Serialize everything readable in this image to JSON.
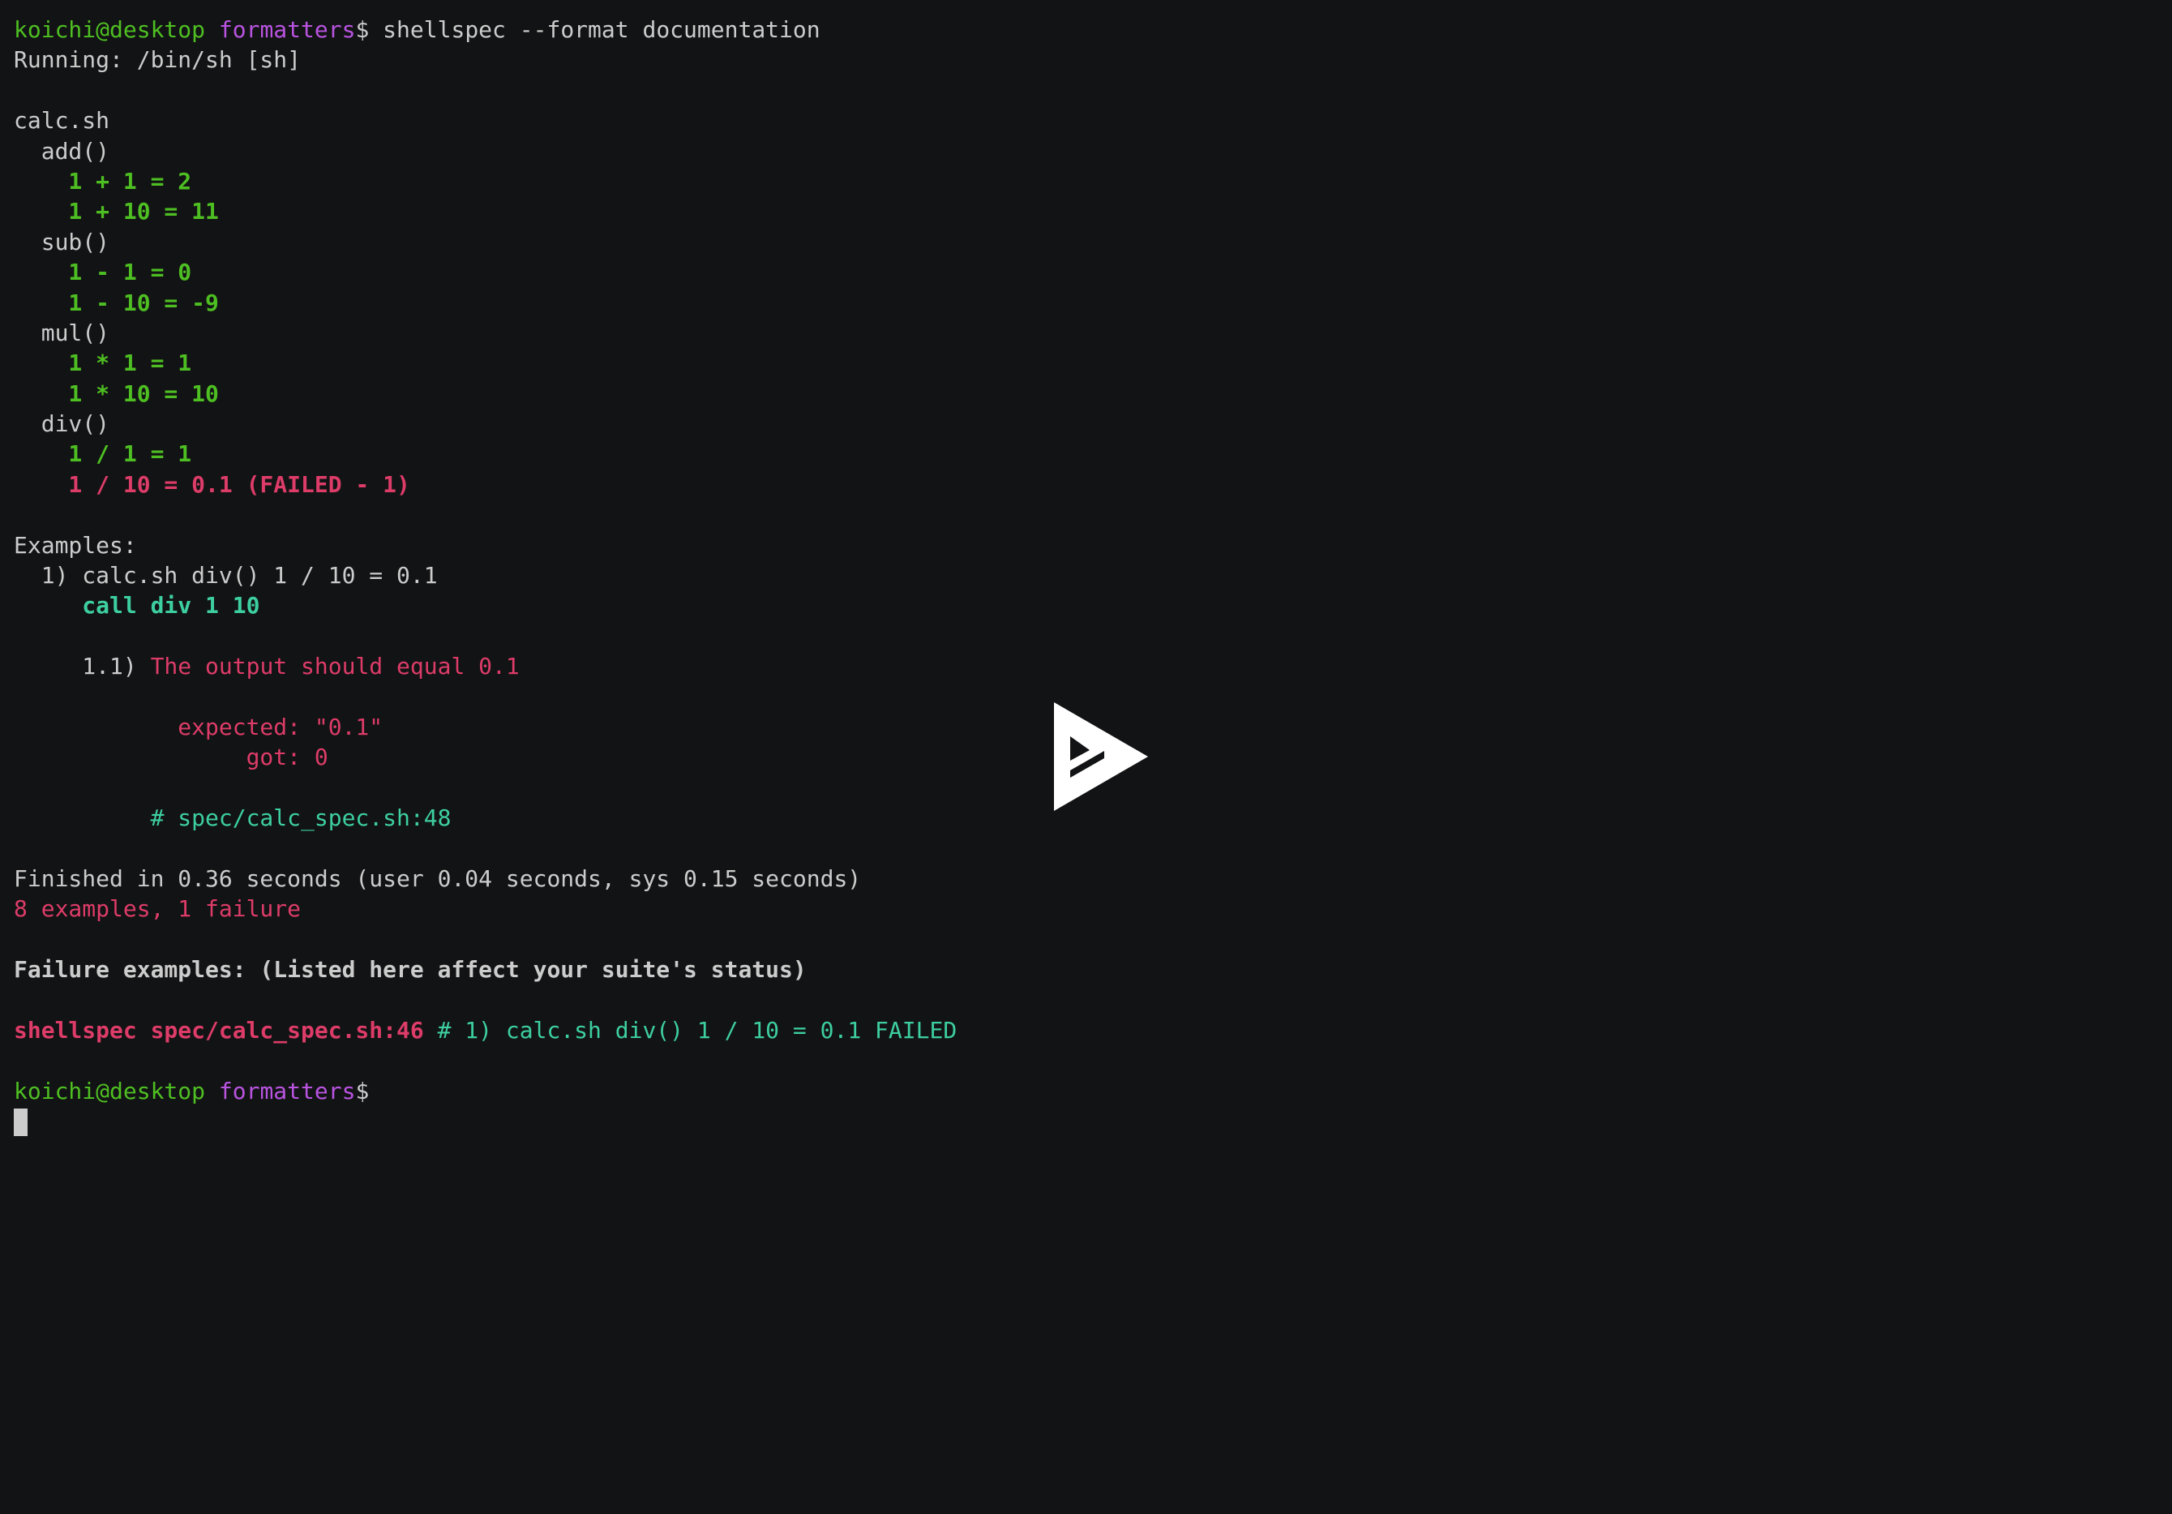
{
  "colors": {
    "background": "#121314",
    "foreground": "#cccccc",
    "green": "#4ebf22",
    "magenta": "#b954e1",
    "red": "#dd3c69",
    "cyan": "#3dcfa0"
  },
  "player": {
    "overlay_icon": "play-icon"
  },
  "terminal": {
    "lines": [
      [
        {
          "text": "koichi@desktop",
          "color": "green",
          "bold": false
        },
        {
          "text": " ",
          "color": "fg",
          "bold": false
        },
        {
          "text": "formatters",
          "color": "magenta",
          "bold": false
        },
        {
          "text": "$ shellspec --format documentation",
          "color": "fg",
          "bold": false
        }
      ],
      [
        {
          "text": "Running: /bin/sh [sh]",
          "color": "fg",
          "bold": false
        }
      ],
      [],
      [
        {
          "text": "calc.sh",
          "color": "fg",
          "bold": false
        }
      ],
      [
        {
          "text": "  add()",
          "color": "fg",
          "bold": false
        }
      ],
      [
        {
          "text": "    1 + 1 = 2",
          "color": "green",
          "bold": true
        }
      ],
      [
        {
          "text": "    1 + 10 = 11",
          "color": "green",
          "bold": true
        }
      ],
      [
        {
          "text": "  sub()",
          "color": "fg",
          "bold": false
        }
      ],
      [
        {
          "text": "    1 - 1 = 0",
          "color": "green",
          "bold": true
        }
      ],
      [
        {
          "text": "    1 - 10 = -9",
          "color": "green",
          "bold": true
        }
      ],
      [
        {
          "text": "  mul()",
          "color": "fg",
          "bold": false
        }
      ],
      [
        {
          "text": "    1 * 1 = 1",
          "color": "green",
          "bold": true
        }
      ],
      [
        {
          "text": "    1 * 10 = 10",
          "color": "green",
          "bold": true
        }
      ],
      [
        {
          "text": "  div()",
          "color": "fg",
          "bold": false
        }
      ],
      [
        {
          "text": "    1 / 1 = 1",
          "color": "green",
          "bold": true
        }
      ],
      [
        {
          "text": "    1 / 10 = 0.1 (FAILED - 1)",
          "color": "red",
          "bold": true
        }
      ],
      [],
      [
        {
          "text": "Examples:",
          "color": "fg",
          "bold": false
        }
      ],
      [
        {
          "text": "  1) calc.sh div() 1 / 10 = 0.1",
          "color": "fg",
          "bold": false
        }
      ],
      [
        {
          "text": "     call div 1 10",
          "color": "cyan",
          "bold": true
        }
      ],
      [],
      [
        {
          "text": "     1.1) ",
          "color": "fg",
          "bold": false
        },
        {
          "text": "The output should equal 0.1",
          "color": "red",
          "bold": false
        }
      ],
      [],
      [
        {
          "text": "            expected: \"0.1\"",
          "color": "red",
          "bold": false
        }
      ],
      [
        {
          "text": "                 got: 0",
          "color": "red",
          "bold": false
        }
      ],
      [],
      [
        {
          "text": "          # spec/calc_spec.sh:48",
          "color": "cyan",
          "bold": false
        }
      ],
      [],
      [
        {
          "text": "Finished in 0.36 seconds (user 0.04 seconds, sys 0.15 seconds)",
          "color": "fg",
          "bold": false
        }
      ],
      [
        {
          "text": "8 examples, 1 failure",
          "color": "red",
          "bold": false
        }
      ],
      [],
      [
        {
          "text": "Failure examples: (Listed here affect your suite's status)",
          "color": "fg",
          "bold": true
        }
      ],
      [],
      [
        {
          "text": "shellspec spec/calc_spec.sh:46",
          "color": "red",
          "bold": true
        },
        {
          "text": " # 1) calc.sh div() 1 / 10 = 0.1 FAILED",
          "color": "cyan",
          "bold": false
        }
      ],
      [],
      [
        {
          "text": "koichi@desktop",
          "color": "green",
          "bold": false
        },
        {
          "text": " ",
          "color": "fg",
          "bold": false
        },
        {
          "text": "formatters",
          "color": "magenta",
          "bold": false
        },
        {
          "text": "$",
          "color": "fg",
          "bold": false
        }
      ],
      [
        {
          "cursor": true
        }
      ]
    ]
  }
}
